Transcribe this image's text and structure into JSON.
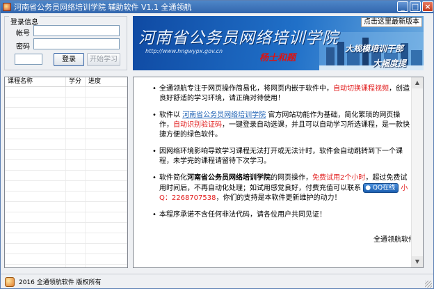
{
  "window": {
    "title": "河南省公务员网络培训学院 辅助软件 V1.1 全通领航",
    "controls": {
      "minimize": "_",
      "maximize": "□",
      "close": "×"
    }
  },
  "login": {
    "group_label": "登录信息",
    "account_label": "帐号",
    "account_value": "",
    "password_label": "密码",
    "password_value": "",
    "captcha_value": "",
    "login_button": "登录",
    "start_button": "开始学习"
  },
  "banner": {
    "title": "河南省公务员网络培训学院",
    "url": "http://www.hngwypx.gov.cn",
    "signature": "杨士和题",
    "slogan_1": "大规模培训干部",
    "slogan_2": "大幅度提",
    "update_link": "点击这里最新版本"
  },
  "course_table": {
    "columns": [
      "课程名称",
      "学分",
      "进度"
    ],
    "rows": []
  },
  "info": {
    "item1": {
      "text": "全通领航专注于网页操作简易化，将网页内嵌于软件中，",
      "highlight": "自动切换课程视频",
      "tail": "，创造良好舒适的学习环境，请正确对待使用！"
    },
    "item2": {
      "pre": "软件以 ",
      "link": "河南省公务员网络培训学院",
      "mid": " 官方网站功能作为基础，简化繁琐的网页操作，",
      "highlight": "自动识别验证码",
      "tail": "，一键登录自动选课，并且可以自动学习所选课程，是一款快捷方便的绿色软件。"
    },
    "item3": {
      "text": "因网络环境影响导致学习课程无法打开或无法计时，软件会自动跳转到下一个课程，未学完的课程请留待下次学习。"
    },
    "item4": {
      "pre": "软件简化",
      "bold": "河南省公务员网络培训学院",
      "mid": "的网页操作，",
      "highlight": "免费试用2个小时",
      "mid2": "，超过免费试用时间后，不再自动化处理；如试用感觉良好，付费充值可以联系",
      "qq_badge": "QQ在线",
      "qq_label": "小Q：2268707538",
      "tail": "，你们的支持是本软件更新维护的动力！"
    },
    "item5": {
      "text": "本程序承诺不含任何非法代码，请各位用户共同见证！"
    },
    "signature": "全通领航软件",
    "bullet": "•"
  },
  "status": {
    "text": "2016 全通领航软件 版权所有"
  }
}
